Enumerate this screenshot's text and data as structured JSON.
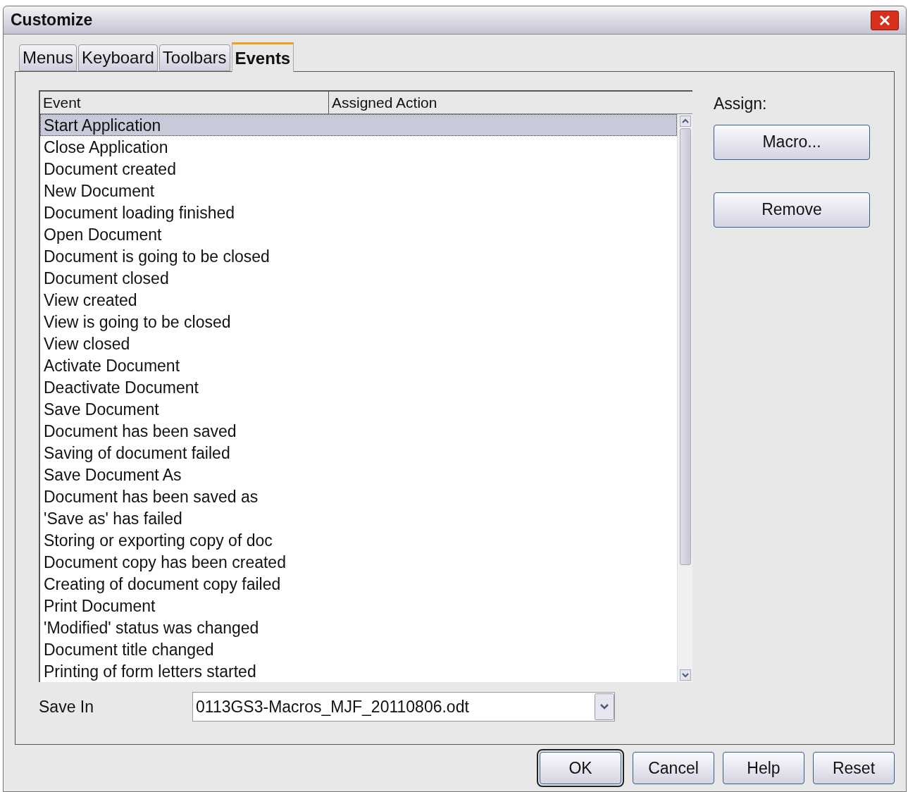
{
  "window": {
    "title": "Customize"
  },
  "tabs": [
    {
      "label": "Menus",
      "selected": false
    },
    {
      "label": "Keyboard",
      "selected": false
    },
    {
      "label": "Toolbars",
      "selected": false
    },
    {
      "label": "Events",
      "selected": true
    }
  ],
  "events_table": {
    "columns": [
      "Event",
      "Assigned Action"
    ],
    "rows": [
      {
        "event": "Start Application",
        "selected": true
      },
      {
        "event": "Close Application",
        "selected": false
      },
      {
        "event": "Document created",
        "selected": false
      },
      {
        "event": "New Document",
        "selected": false
      },
      {
        "event": "Document loading finished",
        "selected": false
      },
      {
        "event": "Open Document",
        "selected": false
      },
      {
        "event": "Document is going to be closed",
        "selected": false
      },
      {
        "event": "Document closed",
        "selected": false
      },
      {
        "event": "View created",
        "selected": false
      },
      {
        "event": "View is going to be closed",
        "selected": false
      },
      {
        "event": "View closed",
        "selected": false
      },
      {
        "event": "Activate Document",
        "selected": false
      },
      {
        "event": "Deactivate Document",
        "selected": false
      },
      {
        "event": "Save Document",
        "selected": false
      },
      {
        "event": "Document has been saved",
        "selected": false
      },
      {
        "event": "Saving of document failed",
        "selected": false
      },
      {
        "event": "Save Document As",
        "selected": false
      },
      {
        "event": "Document has been saved as",
        "selected": false
      },
      {
        "event": "'Save as' has failed",
        "selected": false
      },
      {
        "event": "Storing or exporting copy of doc",
        "selected": false
      },
      {
        "event": "Document copy has been created",
        "selected": false
      },
      {
        "event": "Creating of document copy failed",
        "selected": false
      },
      {
        "event": "Print Document",
        "selected": false
      },
      {
        "event": "'Modified' status was changed",
        "selected": false
      },
      {
        "event": "Document title changed",
        "selected": false
      },
      {
        "event": "Printing of form letters started",
        "selected": false
      }
    ]
  },
  "assign": {
    "label": "Assign:",
    "buttons": [
      "Macro...",
      "Remove"
    ]
  },
  "save_in": {
    "label": "Save In",
    "value": "0113GS3-Macros_MJF_20110806.odt"
  },
  "buttons": [
    {
      "label": "OK",
      "default": true
    },
    {
      "label": "Cancel",
      "default": false
    },
    {
      "label": "Help",
      "default": false
    },
    {
      "label": "Reset",
      "default": false
    }
  ]
}
